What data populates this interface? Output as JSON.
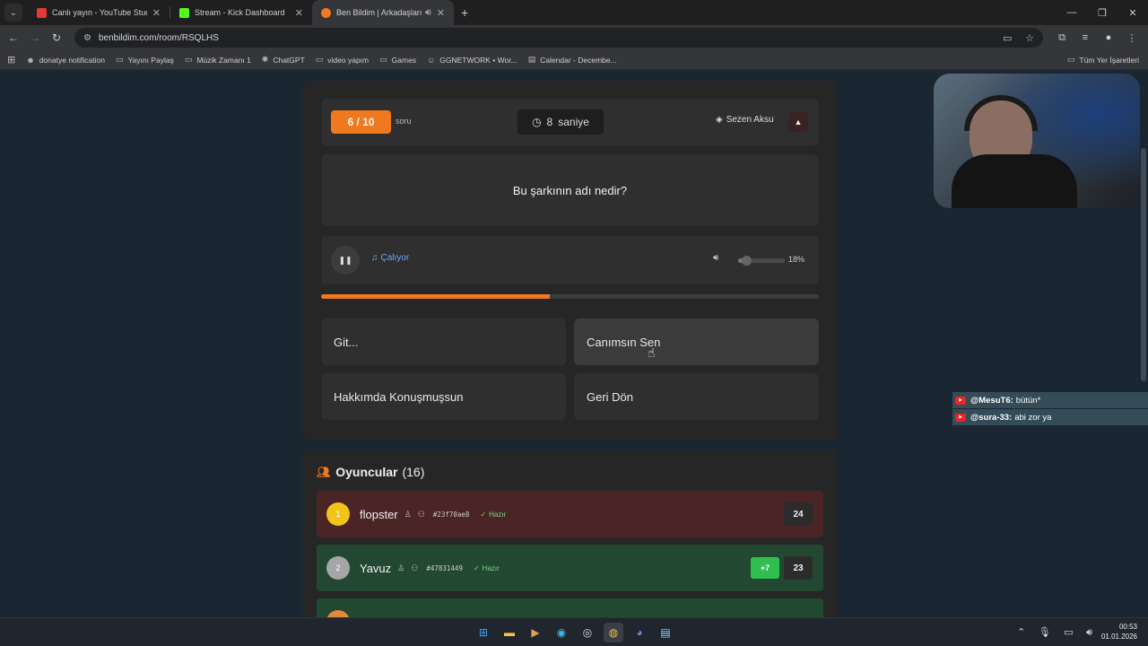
{
  "browser": {
    "tabs": [
      {
        "title": "Canlı yayın - YouTube Studio",
        "active": false,
        "color": "#e53935"
      },
      {
        "title": "Stream - Kick Dashboard",
        "active": false,
        "color": "#53fc18"
      },
      {
        "title": "Ben Bildim | Arkadaşlarınla",
        "active": true,
        "color": "#f0781e"
      }
    ],
    "url": "benbildim.com/room/RSQLHS",
    "bookmarks": [
      {
        "label": "donatye notification",
        "icon": "donate-icon"
      },
      {
        "label": "Yayını Paylaş",
        "icon": "folder-icon"
      },
      {
        "label": "Müzik Zamanı 1",
        "icon": "folder-icon"
      },
      {
        "label": "ChatGPT",
        "icon": "chatgpt-icon"
      },
      {
        "label": "video yapım",
        "icon": "folder-icon"
      },
      {
        "label": "Games",
        "icon": "folder-icon"
      },
      {
        "label": "GGNETWORK • Wor...",
        "icon": "gg-icon"
      },
      {
        "label": "Calendar - Decembe...",
        "icon": "calendar-icon"
      }
    ],
    "bookmarks_right": "Tüm Yer İşaretleri"
  },
  "game": {
    "question_counter": "6 / 10",
    "question_unit": "soru",
    "timer_value": "8",
    "timer_unit": "saniye",
    "artist": "Sezen Aksu",
    "question": "Bu şarkının adı nedir?",
    "playing_label": "Çalıyor",
    "volume_percent_label": "18%",
    "volume_level": 0.18,
    "progress_fraction": 0.46,
    "answers": [
      "Git...",
      "Canımsın Sen",
      "Hakkımda Konuşmuşsun",
      "Geri Dön"
    ]
  },
  "players": {
    "title": "Oyuncular",
    "count": "(16)",
    "rows": [
      {
        "rank": "1",
        "name": "flopster",
        "hash": "#23f70ae8",
        "status": "Hazır",
        "delta": "",
        "score": "24"
      },
      {
        "rank": "2",
        "name": "Yavuz",
        "hash": "#47831449",
        "status": "Hazır",
        "delta": "+7",
        "score": "23"
      }
    ]
  },
  "chat": [
    {
      "user": "@MesuT6:",
      "message": "bütün*"
    },
    {
      "user": "@sura-33:",
      "message": "abi zor ya"
    }
  ],
  "taskbar": {
    "time": "00:53",
    "date": "01.01.2026"
  }
}
